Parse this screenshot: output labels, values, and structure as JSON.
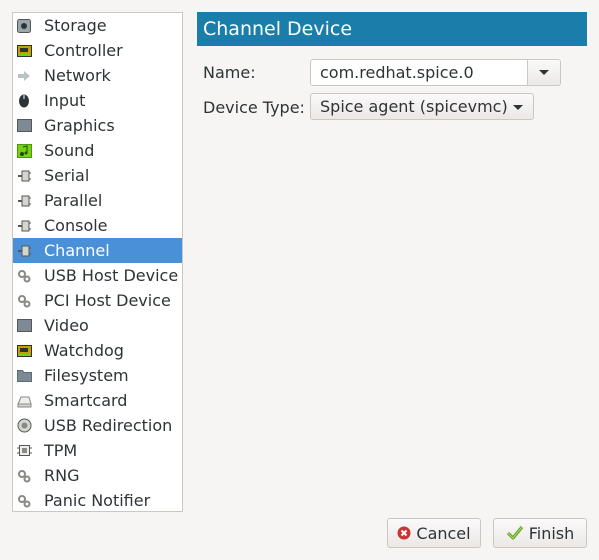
{
  "sidebar": {
    "items": [
      {
        "label": "Storage",
        "icon": "storage-icon"
      },
      {
        "label": "Controller",
        "icon": "controller-icon"
      },
      {
        "label": "Network",
        "icon": "network-icon"
      },
      {
        "label": "Input",
        "icon": "mouse-icon"
      },
      {
        "label": "Graphics",
        "icon": "display-icon"
      },
      {
        "label": "Sound",
        "icon": "sound-icon"
      },
      {
        "label": "Serial",
        "icon": "serial-icon"
      },
      {
        "label": "Parallel",
        "icon": "parallel-icon"
      },
      {
        "label": "Console",
        "icon": "console-icon"
      },
      {
        "label": "Channel",
        "icon": "channel-icon"
      },
      {
        "label": "USB Host Device",
        "icon": "usb-host-icon"
      },
      {
        "label": "PCI Host Device",
        "icon": "pci-host-icon"
      },
      {
        "label": "Video",
        "icon": "video-icon"
      },
      {
        "label": "Watchdog",
        "icon": "watchdog-icon"
      },
      {
        "label": "Filesystem",
        "icon": "folder-icon"
      },
      {
        "label": "Smartcard",
        "icon": "smartcard-icon"
      },
      {
        "label": "USB Redirection",
        "icon": "usb-redirection-icon"
      },
      {
        "label": "TPM",
        "icon": "tpm-icon"
      },
      {
        "label": "RNG",
        "icon": "rng-icon"
      },
      {
        "label": "Panic Notifier",
        "icon": "panic-notifier-icon"
      }
    ],
    "selected": "Channel"
  },
  "header": {
    "title": "Channel Device"
  },
  "form": {
    "name_label": "Name:",
    "name_value": "com.redhat.spice.0",
    "device_type_label": "Device Type:",
    "device_type_value": "Spice agent (spicevmc)"
  },
  "buttons": {
    "cancel": "Cancel",
    "finish": "Finish"
  },
  "colors": {
    "selection": "#4a90d9",
    "header": "#1b7da9",
    "cancel_icon": "#cc3333",
    "finish_icon": "#4e9a06"
  }
}
